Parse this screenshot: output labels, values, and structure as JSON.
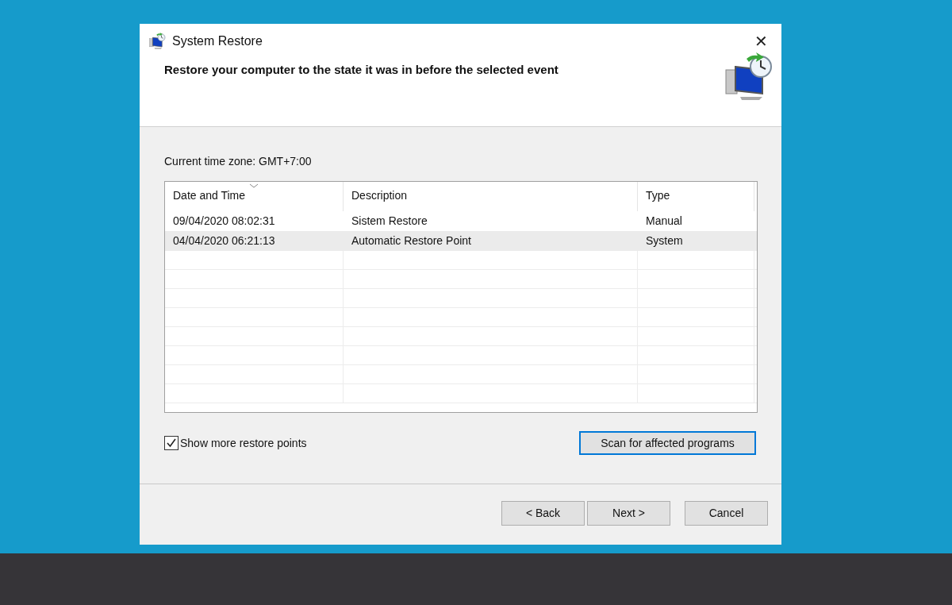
{
  "window": {
    "title": "System Restore",
    "close": "✕"
  },
  "heading": "Restore your computer to the state it was in before the selected event",
  "time_zone": "Current time zone: GMT+7:00",
  "table": {
    "columns": [
      {
        "label": "Date and Time",
        "sorted": true
      },
      {
        "label": "Description",
        "sorted": false
      },
      {
        "label": "Type",
        "sorted": false
      }
    ],
    "rows": [
      {
        "cells": [
          "09/04/2020 08:02:31",
          "Sistem Restore",
          "Manual"
        ],
        "selected": false
      },
      {
        "cells": [
          "04/04/2020 06:21:13",
          "Automatic Restore Point",
          "System"
        ],
        "selected": true
      }
    ]
  },
  "show_more": {
    "label": "Show more restore points",
    "checked": true
  },
  "scan_button": {
    "label": "Scan for affected programs",
    "focused": true
  },
  "buttons": [
    "< Back",
    "Next >",
    "Cancel"
  ]
}
